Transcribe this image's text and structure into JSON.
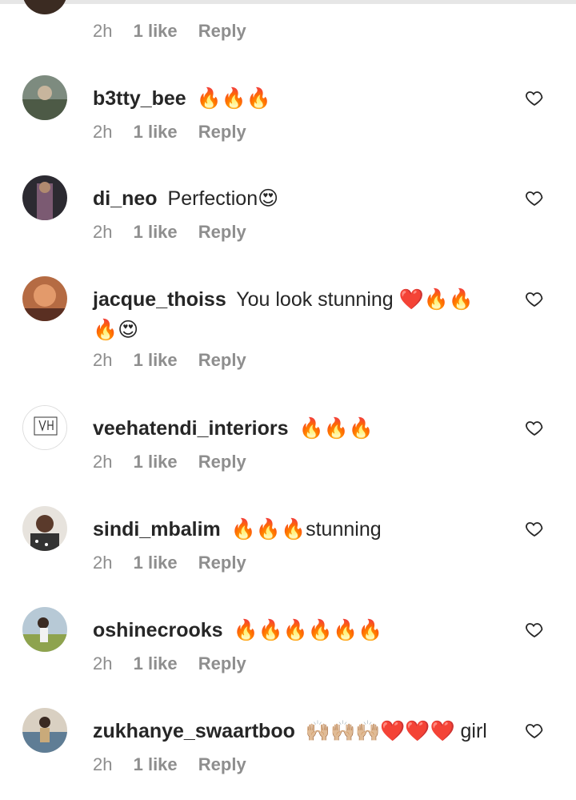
{
  "comments": [
    {
      "user": "",
      "text": "",
      "time": "2h",
      "likes": "1 like",
      "reply": "Reply"
    },
    {
      "user": "b3tty_bee",
      "text": "🔥🔥🔥",
      "time": "2h",
      "likes": "1 like",
      "reply": "Reply"
    },
    {
      "user": "di_neo",
      "text": "Perfection😍",
      "time": "2h",
      "likes": "1 like",
      "reply": "Reply"
    },
    {
      "user": "jacque_thoiss",
      "text": "You look stunning ❤️🔥🔥🔥😍",
      "time": "2h",
      "likes": "1 like",
      "reply": "Reply"
    },
    {
      "user": "veehatendi_interiors",
      "text": "🔥🔥🔥",
      "time": "2h",
      "likes": "1 like",
      "reply": "Reply"
    },
    {
      "user": "sindi_mbalim",
      "text": "🔥🔥🔥stunning",
      "time": "2h",
      "likes": "1 like",
      "reply": "Reply"
    },
    {
      "user": "oshinecrooks",
      "text": "🔥🔥🔥🔥🔥🔥",
      "time": "2h",
      "likes": "1 like",
      "reply": "Reply"
    },
    {
      "user": "zukhanye_swaartboo",
      "text": "🙌🏼🙌🏼🙌🏼❤️❤️❤️ girl",
      "time": "2h",
      "likes": "1 like",
      "reply": "Reply"
    }
  ],
  "icons": {
    "heart": "heart-outline-icon"
  },
  "colors": {
    "text": "#262626",
    "meta": "#8e8e8e"
  }
}
